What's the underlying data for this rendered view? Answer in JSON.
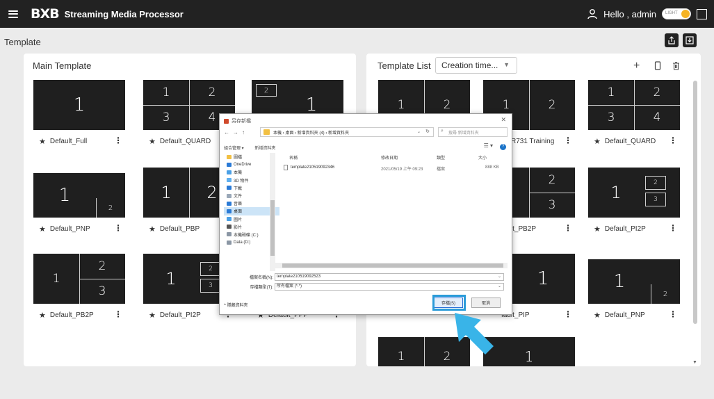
{
  "topbar": {
    "logo": "BXB",
    "title": "Streaming Media Processor",
    "greeting": "Hello , admin",
    "theme_label": "LIGHT"
  },
  "page": {
    "title": "Template"
  },
  "main_template": {
    "title": "Main Template",
    "cards": [
      {
        "name": "Default_Full",
        "layout": "full",
        "numbers": [
          "1"
        ]
      },
      {
        "name": "Default_QUARD",
        "layout": "quad",
        "numbers": [
          "1",
          "2",
          "3",
          "4"
        ]
      },
      {
        "name": "",
        "layout": "pip-topleft",
        "numbers": [
          "1",
          "2"
        ]
      },
      {
        "name": "Default_PNP",
        "layout": "pnp",
        "numbers": [
          "1",
          "2"
        ]
      },
      {
        "name": "Default_PBP",
        "layout": "pbp",
        "numbers": [
          "1",
          "2"
        ]
      },
      {
        "name": "Default_PB2P",
        "layout": "pb2p",
        "numbers": [
          "1",
          "2",
          "3"
        ]
      },
      {
        "name": "Default_PI2P",
        "layout": "pi2p-partial",
        "numbers": [
          "1",
          "2",
          "3"
        ]
      },
      {
        "name": "Default_PPP",
        "layout": "",
        "numbers": []
      }
    ]
  },
  "template_list": {
    "title": "Template List",
    "sort_value": "Creation time...",
    "cards": [
      {
        "name": "",
        "layout": "pbp",
        "numbers": [
          "1",
          "2"
        ]
      },
      {
        "name": "R731 Training",
        "layout": "pbp",
        "numbers": [
          "1",
          "2"
        ]
      },
      {
        "name": "Default_QUARD",
        "layout": "quad",
        "numbers": [
          "1",
          "2",
          "3",
          "4"
        ]
      },
      {
        "name": "fault_PB2P",
        "layout": "pb2p-partial",
        "numbers": [
          "2",
          "3"
        ]
      },
      {
        "name": "Default_PI2P",
        "layout": "pi2p",
        "numbers": [
          "1",
          "2",
          "3"
        ]
      },
      {
        "name": "",
        "layout": "",
        "numbers": []
      },
      {
        "name": "fault_PIP",
        "layout": "pip-partial",
        "numbers": [
          "1"
        ]
      },
      {
        "name": "Default_PNP",
        "layout": "pnp",
        "numbers": [
          "1",
          "2"
        ]
      },
      {
        "name": "",
        "layout": "pbp",
        "numbers": [
          "1",
          "2"
        ]
      },
      {
        "name": "",
        "layout": "full-partial",
        "numbers": [
          "1"
        ]
      }
    ]
  },
  "dialog": {
    "title": "另存新檔",
    "path": "本機 › 桌面 › 新增資料夾 (4) › 新增資料夾",
    "search_placeholder": "搜尋 新增資料夾",
    "organize": "組合管理 ▾",
    "new_folder": "新增資料夾",
    "tree": [
      "圖檔",
      "OneDrive",
      "本機",
      "3D 物件",
      "下載",
      "文件",
      "音樂",
      "桌面",
      "圖片",
      "影片",
      "本機磁碟 (C:)",
      "Data (D:)"
    ],
    "headers": {
      "name": "名稱",
      "date": "修改日期",
      "type": "類型",
      "size": "大小"
    },
    "file": {
      "name": "template210519092346",
      "date": "2021/05/19 上午 09:23",
      "type": "檔案",
      "size": "888 KB"
    },
    "filename_label": "檔案名稱(N):",
    "filename_value": "template210519092523",
    "filetype_label": "存檔類型(T):",
    "filetype_value": "所有檔案 (*.*)",
    "hide_folders": "隱藏資料夾",
    "save_button": "存檔(S)",
    "cancel_button": "取消"
  }
}
